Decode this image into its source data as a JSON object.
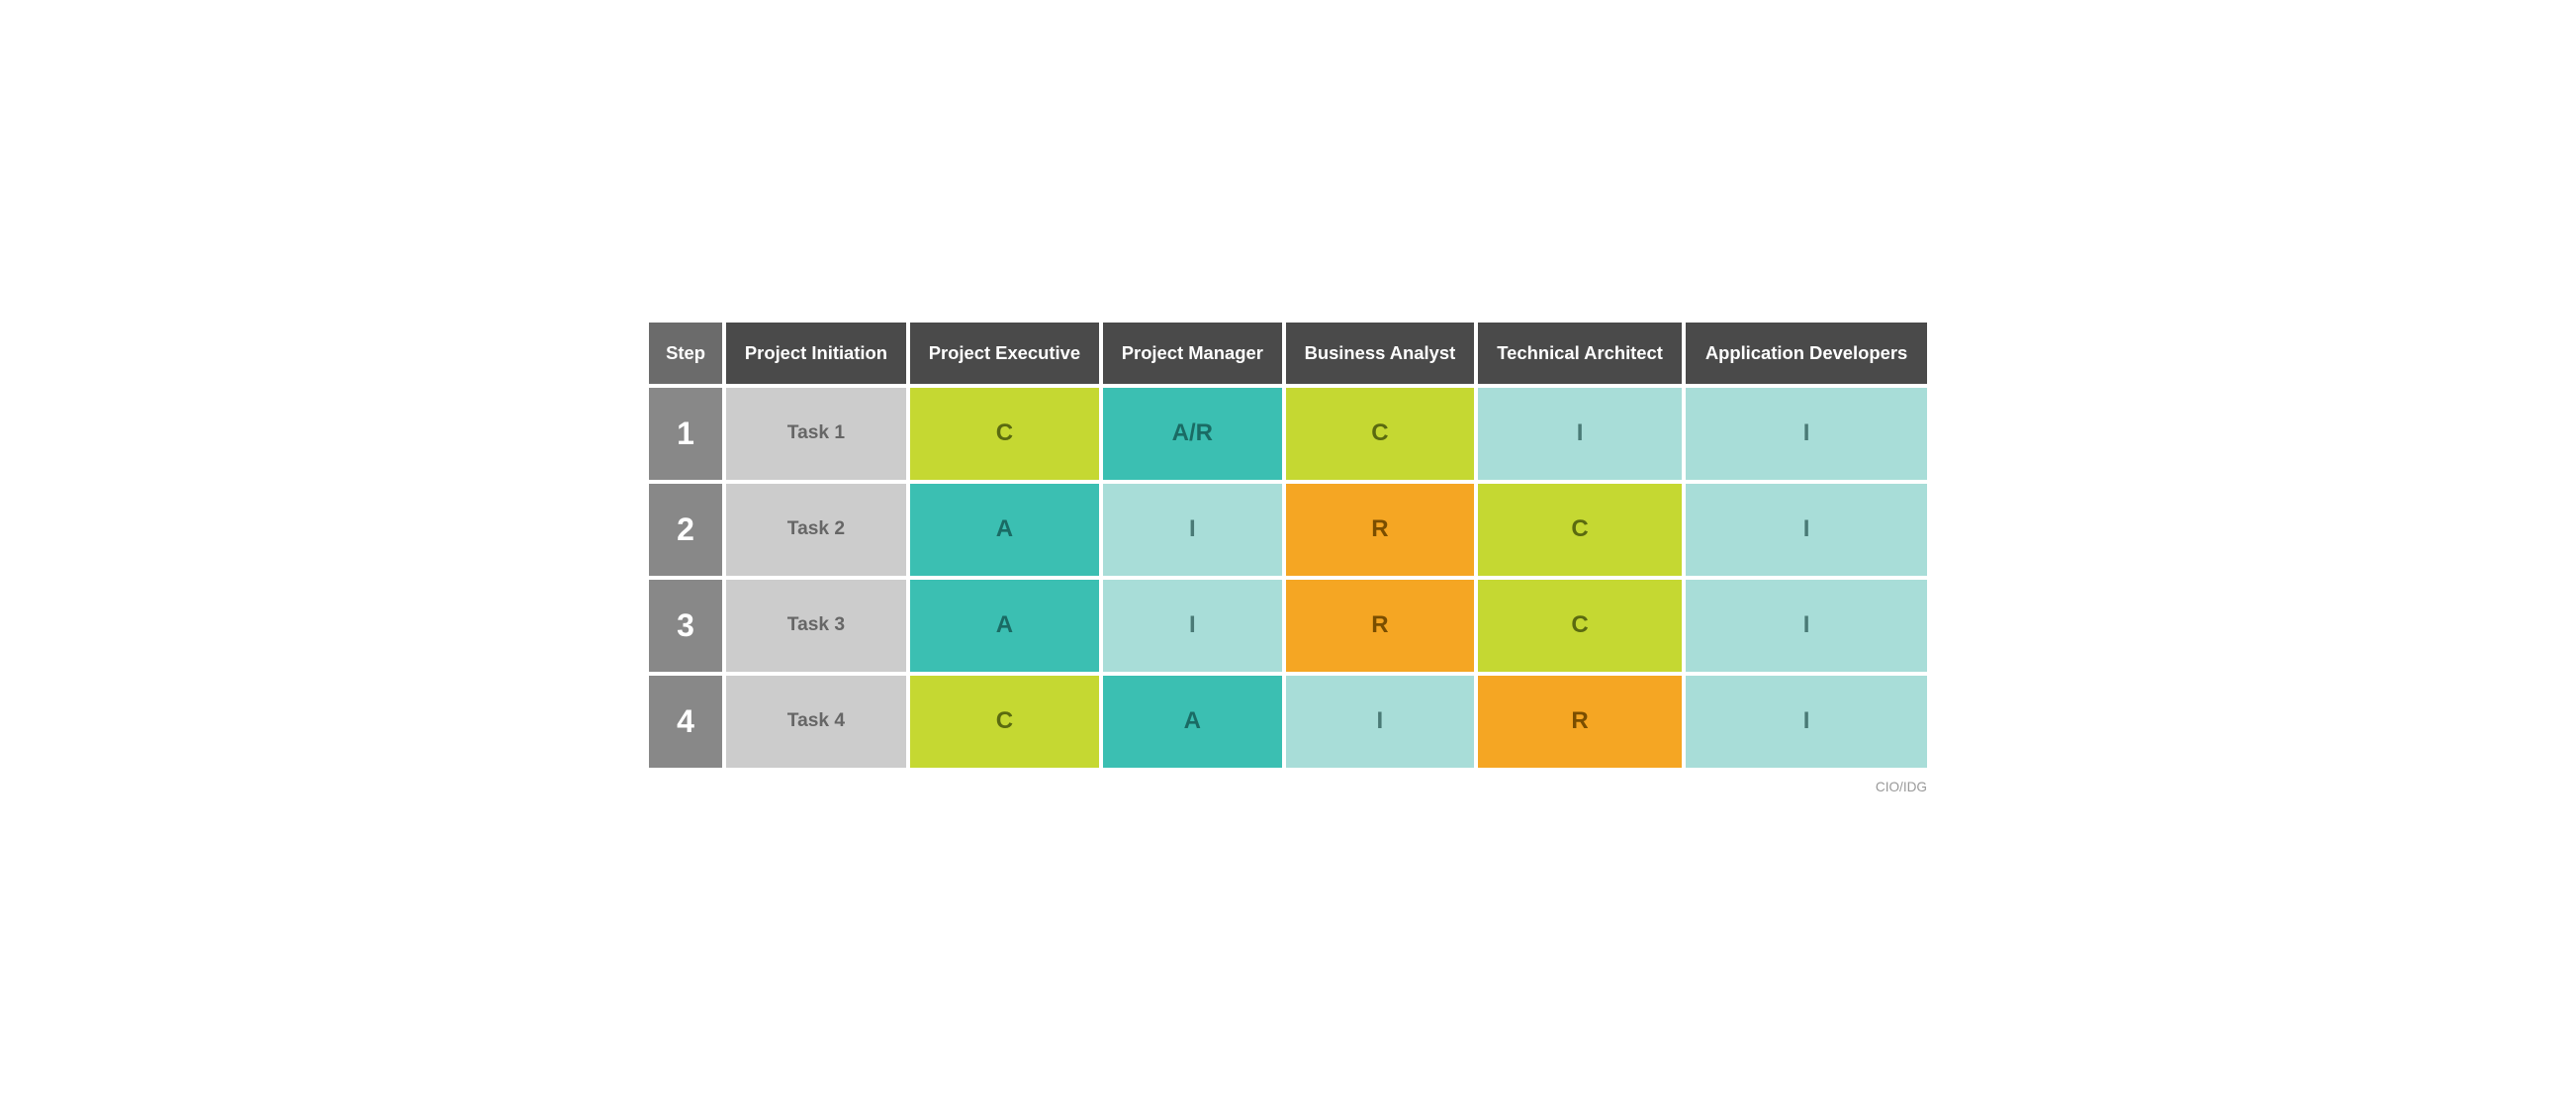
{
  "headers": {
    "step": "Step",
    "project_initiation": "Project Initiation",
    "project_executive": "Project Executive",
    "project_manager": "Project Manager",
    "business_analyst": "Business Analyst",
    "technical_architect": "Technical Architect",
    "application_developers": "Application Developers"
  },
  "rows": [
    {
      "step": "1",
      "task": "Task 1",
      "project_executive": {
        "value": "C",
        "color": "yellow-green"
      },
      "project_manager": {
        "value": "A/R",
        "color": "teal"
      },
      "business_analyst": {
        "value": "C",
        "color": "yellow-green"
      },
      "technical_architect": {
        "value": "I",
        "color": "light-teal"
      },
      "application_developers": {
        "value": "I",
        "color": "light-teal"
      }
    },
    {
      "step": "2",
      "task": "Task 2",
      "project_executive": {
        "value": "A",
        "color": "teal"
      },
      "project_manager": {
        "value": "I",
        "color": "light-teal"
      },
      "business_analyst": {
        "value": "R",
        "color": "orange"
      },
      "technical_architect": {
        "value": "C",
        "color": "yellow-green"
      },
      "application_developers": {
        "value": "I",
        "color": "light-teal"
      }
    },
    {
      "step": "3",
      "task": "Task 3",
      "project_executive": {
        "value": "A",
        "color": "teal"
      },
      "project_manager": {
        "value": "I",
        "color": "light-teal"
      },
      "business_analyst": {
        "value": "R",
        "color": "orange"
      },
      "technical_architect": {
        "value": "C",
        "color": "yellow-green"
      },
      "application_developers": {
        "value": "I",
        "color": "light-teal"
      }
    },
    {
      "step": "4",
      "task": "Task 4",
      "project_executive": {
        "value": "C",
        "color": "yellow-green"
      },
      "project_manager": {
        "value": "A",
        "color": "teal"
      },
      "business_analyst": {
        "value": "I",
        "color": "light-teal"
      },
      "technical_architect": {
        "value": "R",
        "color": "orange"
      },
      "application_developers": {
        "value": "I",
        "color": "light-teal"
      }
    }
  ],
  "watermark": "CIO/IDG"
}
